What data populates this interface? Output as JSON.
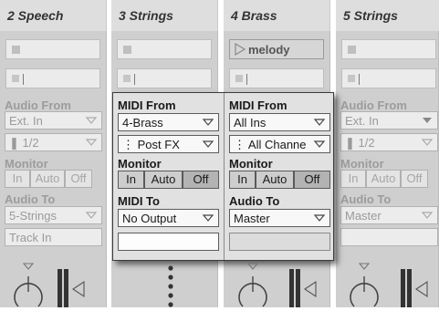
{
  "tracks": [
    {
      "title": "2 Speech"
    },
    {
      "title": "3 Strings"
    },
    {
      "title": "4 Brass",
      "clip": "melody"
    },
    {
      "title": "5 Strings"
    }
  ],
  "io_labels": {
    "audio_from": "Audio From",
    "midi_from": "MIDI From",
    "monitor": "Monitor",
    "audio_to": "Audio To",
    "midi_to": "MIDI To",
    "monitor_in": "In",
    "monitor_auto": "Auto",
    "monitor_off": "Off"
  },
  "track2": {
    "input_type": "Ext. In",
    "input_channel": "1/2",
    "output": "5-Strings",
    "track_in": "Track In"
  },
  "track3": {
    "midi_from": "4-Brass",
    "midi_from_channel": "Post FX",
    "midi_to": "No Output",
    "monitor_selected": "Off"
  },
  "track4": {
    "midi_from": "All Ins",
    "midi_from_channel": "All Channe",
    "audio_to": "Master",
    "monitor_selected": "Off"
  },
  "track5": {
    "input_type": "Ext. In",
    "input_channel": "1/2",
    "output": "Master"
  }
}
